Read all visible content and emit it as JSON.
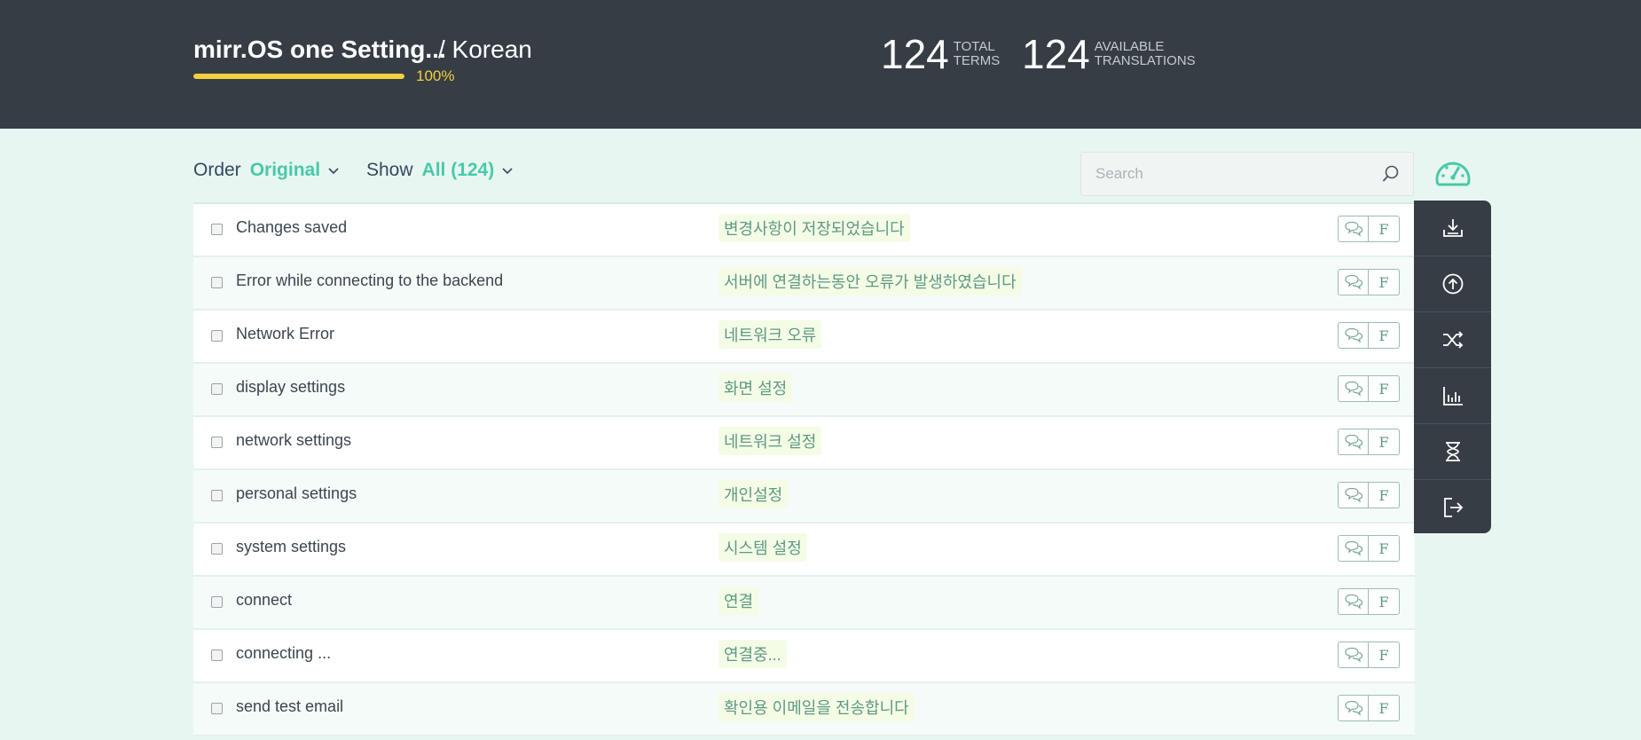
{
  "header": {
    "project_title": "mirr.OS one Setting...",
    "language": "/ Korean",
    "progress_percent": 100,
    "progress_label": "100%",
    "stats": [
      {
        "number": "124",
        "label_line1": "TOTAL",
        "label_line2": "TERMS"
      },
      {
        "number": "124",
        "label_line1": "AVAILABLE",
        "label_line2": "TRANSLATIONS"
      }
    ]
  },
  "toolbar": {
    "order_label": "Order",
    "order_value": "Original",
    "show_label": "Show",
    "show_value": "All (124)"
  },
  "search": {
    "placeholder": "Search",
    "value": ""
  },
  "terms": [
    {
      "source": "Changes saved",
      "translation": "변경사항이 저장되었습니다"
    },
    {
      "source": "Error while connecting to the backend",
      "translation": "서버에 연결하는동안 오류가 발생하였습니다"
    },
    {
      "source": "Network Error",
      "translation": "네트워크 오류"
    },
    {
      "source": "display settings",
      "translation": "화면 설정"
    },
    {
      "source": "network settings",
      "translation": "네트워크 설정"
    },
    {
      "source": "personal settings",
      "translation": "개인설정"
    },
    {
      "source": "system settings",
      "translation": "시스템 설정"
    },
    {
      "source": "connect",
      "translation": "연결"
    },
    {
      "source": "connecting ...",
      "translation": "연결중..."
    },
    {
      "source": "send test email",
      "translation": "확인용 이메일을 전송합니다"
    }
  ],
  "row_actions": {
    "fuzzy_label": "F"
  },
  "colors": {
    "header_bg": "#363d45",
    "accent": "#48c9a9",
    "progress": "#f4d03f",
    "page_bg": "#e8f6f1"
  },
  "icons": {
    "dashboard": "speedometer-icon",
    "side_panel": [
      "download-icon",
      "upload-icon",
      "shuffle-icon",
      "bar-chart-icon",
      "hourglass-icon",
      "logout-icon"
    ],
    "row": [
      "comments-icon"
    ]
  }
}
